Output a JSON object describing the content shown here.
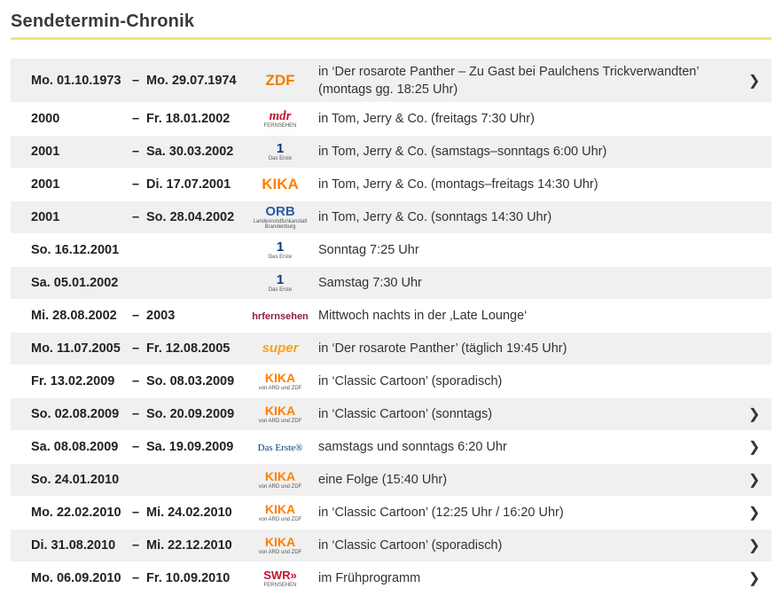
{
  "page": {
    "title": "Sendetermin-Chronik"
  },
  "rows": [
    {
      "start": "Mo. 01.10.1973",
      "dash": "–",
      "end": "Mo. 29.07.1974",
      "logo": "ZDF",
      "logo_small": "",
      "desc": "in ‘Der rosarote Panther – Zu Gast bei Paulchens Trickverwandten’ (montags gg. 18:25 Uhr)",
      "arrow": "❯"
    },
    {
      "start": "2000",
      "dash": "–",
      "end": "Fr. 18.01.2002",
      "logo": "mdr",
      "logo_small": "FERNSEHEN",
      "desc": "in Tom, Jerry & Co. (freitags 7:30 Uhr)",
      "arrow": ""
    },
    {
      "start": "2001",
      "dash": "–",
      "end": "Sa. 30.03.2002",
      "logo": "1",
      "logo_small": "Das Erste",
      "desc": "in Tom, Jerry & Co. (samstags–sonntags 6:00 Uhr)",
      "arrow": ""
    },
    {
      "start": "2001",
      "dash": "–",
      "end": "Di. 17.07.2001",
      "logo": "KIKA",
      "logo_small": "",
      "desc": "in Tom, Jerry & Co. (montags–freitags 14:30 Uhr)",
      "arrow": ""
    },
    {
      "start": "2001",
      "dash": "–",
      "end": "So. 28.04.2002",
      "logo": "ORB",
      "logo_small": "Landesrundfunkanstalt Brandenburg",
      "desc": "in Tom, Jerry & Co. (sonntags 14:30 Uhr)",
      "arrow": ""
    },
    {
      "start": "So. 16.12.2001",
      "dash": "",
      "end": "",
      "logo": "1",
      "logo_small": "Das Erste",
      "desc": "Sonntag 7:25 Uhr",
      "arrow": ""
    },
    {
      "start": "Sa. 05.01.2002",
      "dash": "",
      "end": "",
      "logo": "1",
      "logo_small": "Das Erste",
      "desc": "Samstag 7:30 Uhr",
      "arrow": ""
    },
    {
      "start": "Mi. 28.08.2002",
      "dash": "–",
      "end": "2003",
      "logo": "hrfernsehen",
      "logo_small": "",
      "desc": "Mittwoch nachts in der ‚Late Lounge‘",
      "arrow": ""
    },
    {
      "start": "Mo. 11.07.2005",
      "dash": "–",
      "end": "Fr. 12.08.2005",
      "logo": "super",
      "logo_small": "",
      "desc": "in ‘Der rosarote Panther’ (täglich 19:45 Uhr)",
      "arrow": ""
    },
    {
      "start": "Fr. 13.02.2009",
      "dash": "–",
      "end": "So. 08.03.2009",
      "logo": "KIKA",
      "logo_small": "von ARD und ZDF",
      "desc": "in ‘Classic Cartoon’ (sporadisch)",
      "arrow": ""
    },
    {
      "start": "So. 02.08.2009",
      "dash": "–",
      "end": "So. 20.09.2009",
      "logo": "KIKA",
      "logo_small": "von ARD und ZDF",
      "desc": "in ‘Classic Cartoon’ (sonntags)",
      "arrow": "❯"
    },
    {
      "start": "Sa. 08.08.2009",
      "dash": "–",
      "end": "Sa. 19.09.2009",
      "logo": "Das Erste®",
      "logo_small": "",
      "desc": "samstags und sonntags 6:20 Uhr",
      "arrow": "❯"
    },
    {
      "start": "So. 24.01.2010",
      "dash": "",
      "end": "",
      "logo": "KIKA",
      "logo_small": "von ARD und ZDF",
      "desc": "eine Folge (15:40 Uhr)",
      "arrow": "❯"
    },
    {
      "start": "Mo. 22.02.2010",
      "dash": "–",
      "end": "Mi. 24.02.2010",
      "logo": "KIKA",
      "logo_small": "von ARD und ZDF",
      "desc": "in ‘Classic Cartoon’ (12:25 Uhr / 16:20 Uhr)",
      "arrow": "❯"
    },
    {
      "start": "Di. 31.08.2010",
      "dash": "–",
      "end": "Mi. 22.12.2010",
      "logo": "KIKA",
      "logo_small": "von ARD und ZDF",
      "desc": "in ‘Classic Cartoon’ (sporadisch)",
      "arrow": "❯"
    },
    {
      "start": "Mo. 06.09.2010",
      "dash": "–",
      "end": "Fr. 10.09.2010",
      "logo": "SWR»",
      "logo_small": "FERNSEHEN",
      "desc": "im Frühprogramm",
      "arrow": "❯"
    }
  ],
  "colors": {
    "title_rule": "#f2e27a",
    "row_alt": "#f0f0f0",
    "zdf": "#ef7d00",
    "kika": "#ff7f00",
    "orb": "#2a5da8",
    "das_erste": "#0b3a7a",
    "hr": "#8a1e3a",
    "super": "#f7a21b",
    "swr": "#c8102e"
  }
}
